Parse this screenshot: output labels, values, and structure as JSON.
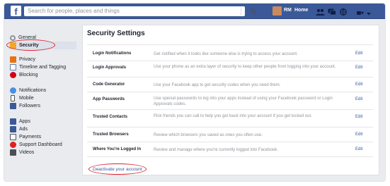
{
  "header": {
    "logo": "f",
    "search_placeholder": "Search for people, places and things",
    "search_button_icon": "search-icon",
    "user_short": "RM",
    "home": "Home"
  },
  "sidebar": {
    "items": [
      {
        "label": "General",
        "icon": "gear-icon",
        "color": "#8d949e"
      },
      {
        "label": "Security",
        "icon": "shield-icon",
        "color": "#f5a623"
      },
      {
        "label": "Privacy",
        "icon": "lock-icon",
        "color": "#e9710f"
      },
      {
        "label": "Timeline and Tagging",
        "icon": "timeline-icon",
        "color": "#5b7bb4"
      },
      {
        "label": "Blocking",
        "icon": "block-icon",
        "color": "#d0021b"
      },
      {
        "label": "Notifications",
        "icon": "globe-icon",
        "color": "#4a90e2"
      },
      {
        "label": "Mobile",
        "icon": "mobile-icon",
        "color": "#4b4f56"
      },
      {
        "label": "Followers",
        "icon": "followers-icon",
        "color": "#3b5998"
      },
      {
        "label": "Apps",
        "icon": "apps-icon",
        "color": "#3b5998"
      },
      {
        "label": "Ads",
        "icon": "ads-icon",
        "color": "#3b5998"
      },
      {
        "label": "Payments",
        "icon": "payments-icon",
        "color": "#4b4f56"
      },
      {
        "label": "Support Dashboard",
        "icon": "support-icon",
        "color": "#e02020"
      },
      {
        "label": "Videos",
        "icon": "video-icon",
        "color": "#4b4f56"
      }
    ]
  },
  "main": {
    "title": "Security Settings",
    "rows": [
      {
        "label": "Login Notifications",
        "desc": "Get notified when it looks like someone else is trying to access your account.",
        "edit": "Edit"
      },
      {
        "label": "Login Approvals",
        "desc": "Use your phone as an extra layer of security to keep other people from logging into your account.",
        "edit": "Edit"
      },
      {
        "label": "Code Generator",
        "desc": "Use your Facebook app to get security codes when you need them.",
        "edit": "Edit"
      },
      {
        "label": "App Passwords",
        "desc": "Use special passwords to log into your apps instead of using your Facebook password or Login Approvals codes.",
        "edit": "Edit"
      },
      {
        "label": "Trusted Contacts",
        "desc": "Pick friends you can call to help you get back into your account if you get locked out.",
        "edit": "Edit"
      },
      {
        "label": "Trusted Browsers",
        "desc": "Review which browsers you saved as ones you often use.",
        "edit": "Edit"
      },
      {
        "label": "Where You're Logged In",
        "desc": "Review and manage where you're currently logged into Facebook.",
        "edit": "Edit"
      }
    ],
    "deactivate": "Deactivate your account"
  },
  "colors": {
    "brand": "#3b5998",
    "highlight": "#e0202a"
  }
}
